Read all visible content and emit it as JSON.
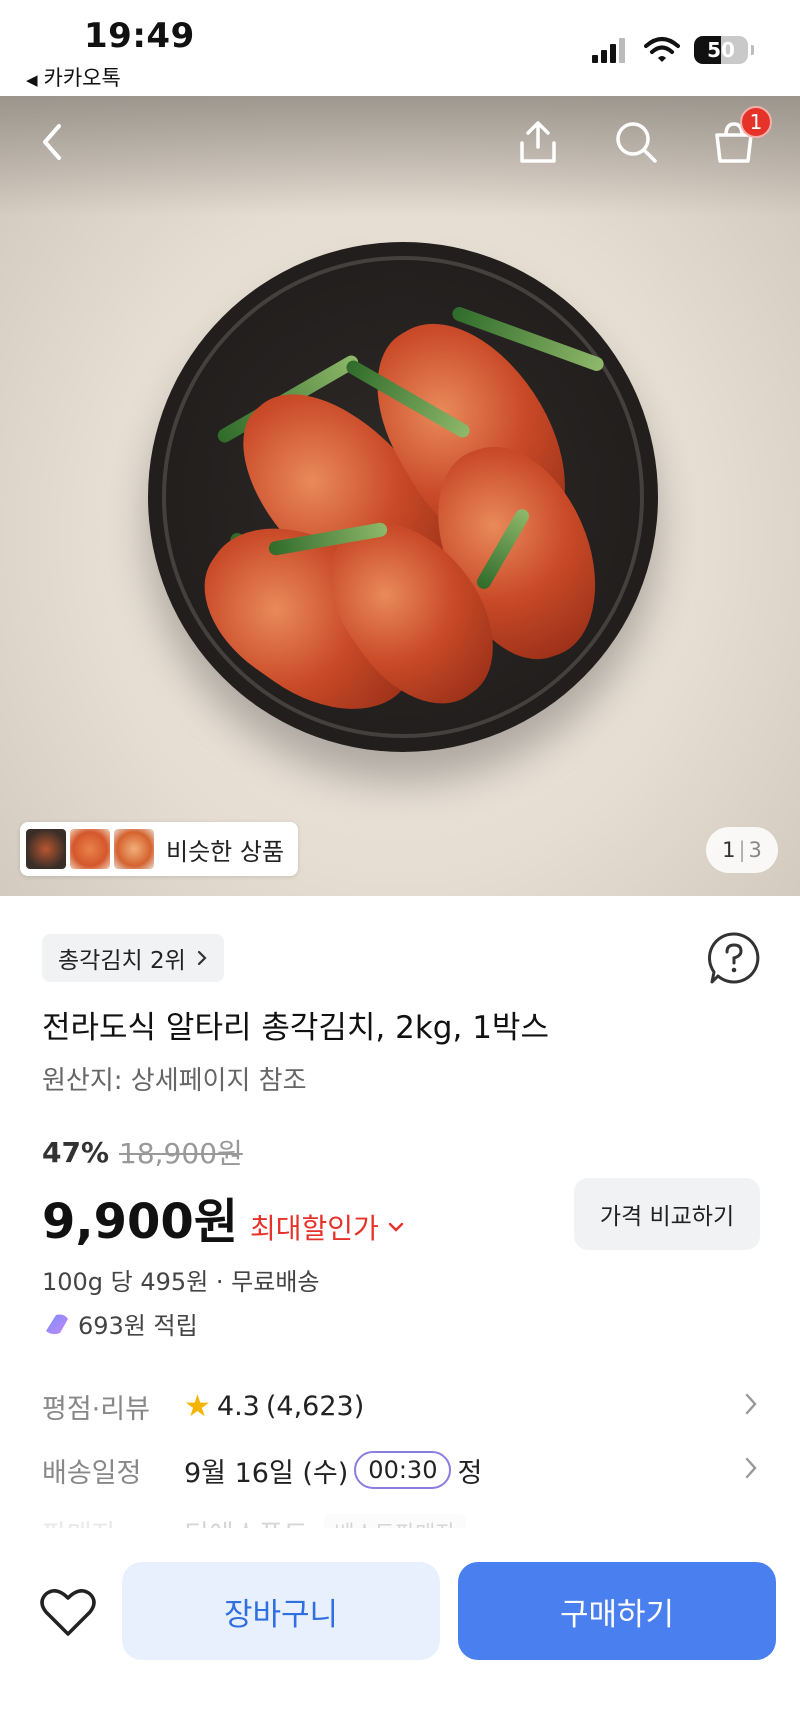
{
  "status_bar": {
    "time": "19:49",
    "back_app": "카카오톡",
    "battery": "50"
  },
  "header": {
    "cart_count": "1"
  },
  "hero": {
    "similar_label": "비슷한 상품",
    "page_current": "1",
    "page_total": "3"
  },
  "product": {
    "rank_label": "총각김치 2위",
    "title": "전라도식 알타리 총각김치, 2kg, 1박스",
    "origin": "원산지: 상세페이지 참조",
    "discount_rate": "47%",
    "original_price": "18,900원",
    "price": "9,900원",
    "max_discount_label": "최대할인가",
    "compare_label": "가격 비교하기",
    "unit_price": "100g 당 495원 · 무료배송",
    "points": "693원 적립"
  },
  "details": {
    "rating_key": "평점·리뷰",
    "rating": "4.3",
    "review_count": "(4,623)",
    "delivery_key": "배송일정",
    "delivery_date": "9월 16일 (수)",
    "delivery_time": "00:30",
    "delivery_suffix": "정",
    "seller_key": "판매자",
    "seller_name": "티에스푸드",
    "seller_badge": "베스트판매자"
  },
  "actions": {
    "cart_label": "장바구니",
    "buy_label": "구매하기"
  },
  "colors": {
    "accent": "#4a7fef",
    "discount_red": "#e6332a",
    "star": "#f4b400"
  }
}
